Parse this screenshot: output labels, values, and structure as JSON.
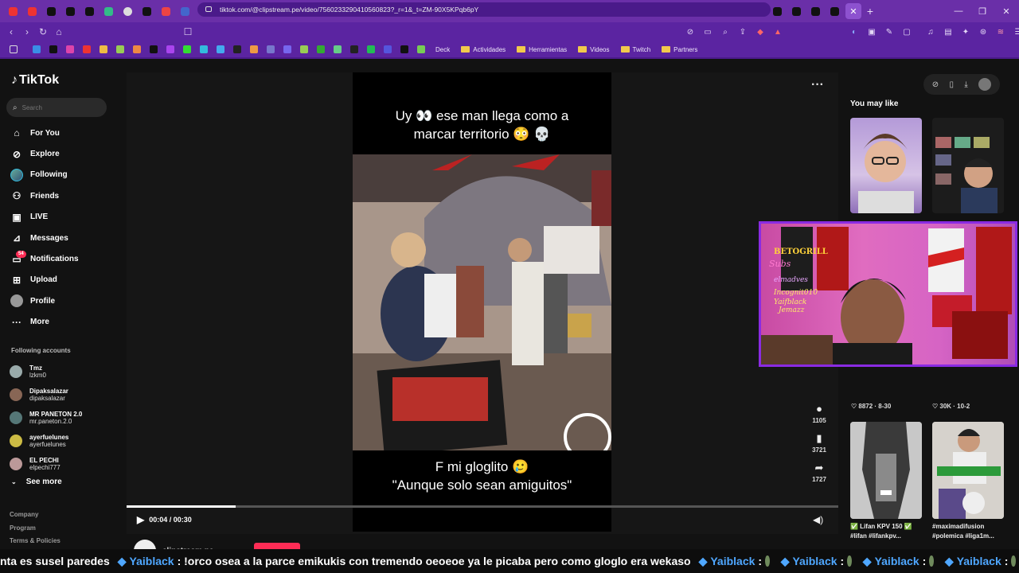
{
  "browser": {
    "url": "tiktok.com/@clipstream.pe/video/7560233290410560823?_r=1&_t=ZM-90X5KPqb6pY",
    "bookmarks": [
      "Deck",
      "Actividades",
      "Herramientas",
      "Videos",
      "Twitch",
      "Partners"
    ]
  },
  "sidebar": {
    "brand": "TikTok",
    "search_placeholder": "Search",
    "menu": [
      {
        "label": "For You",
        "icon": "home-icon"
      },
      {
        "label": "Explore",
        "icon": "compass-icon"
      },
      {
        "label": "Following",
        "icon": "following-avatar"
      },
      {
        "label": "Friends",
        "icon": "friends-icon"
      },
      {
        "label": "LIVE",
        "icon": "live-icon"
      },
      {
        "label": "Messages",
        "icon": "messages-icon"
      },
      {
        "label": "Notifications",
        "icon": "notifications-icon"
      },
      {
        "label": "Upload",
        "icon": "upload-icon"
      },
      {
        "label": "Profile",
        "icon": "profile-avatar"
      },
      {
        "label": "More",
        "icon": "more-icon"
      }
    ],
    "notifications_badge": "54",
    "following_header": "Following accounts",
    "accounts": [
      {
        "name": "Tmz",
        "user": "lzkm0"
      },
      {
        "name": "Dipaksalazar",
        "user": "dipaksalazar"
      },
      {
        "name": "MR PANETON 2.0",
        "user": "mr.paneton.2.0"
      },
      {
        "name": "ayerfuelunes",
        "user": "ayerfuelunes"
      },
      {
        "name": "EL PECHI",
        "user": "elpechi777"
      }
    ],
    "see_more": "See more",
    "footer": [
      "Company",
      "Program",
      "Terms & Policies"
    ]
  },
  "video": {
    "caption_top_1": "Uy 👀 ese man llega como a",
    "caption_top_2": "marcar territorio 😳 💀",
    "caption_bottom_1": "F mi gloglito 🥲",
    "caption_bottom_2": "\"Aunque solo sean amiguitos\"",
    "time": "00:04 / 00:30",
    "progress": 0.153,
    "comments": "1105",
    "saves": "3721",
    "shares": "1727",
    "creator": "clipstream.pe"
  },
  "right": {
    "you_may_like": "You may like",
    "stats_left": "♡ 8872 · 8-30",
    "stats_right": "♡ 30K · 10-2",
    "title_left_1": "✅ Lifan KPV 150 ✅",
    "title_left_2": "#lifan #lifankpv...",
    "title_right_1": "#maximadifusion",
    "title_right_2": "#polemica #liga1m..."
  },
  "cam": {
    "lines": [
      "BETOGRILL",
      "Subs",
      "elmadves",
      "Incognit010",
      "Yaifblack",
      "Jemazz"
    ]
  },
  "ticker": {
    "lead": "nta es susel paredes",
    "user1": "Yaiblack",
    "msg1": ": !orco osea a la parce emikukis con tremendo oeoeoe ya le picaba pero como gloglo era wekaso",
    "user2": "Yaiblack",
    "user3": "Yaiblack",
    "user4": "Yaiblack",
    "user5": "Yaiblack",
    "colon": ":"
  },
  "colors": {
    "accent": "#fe2c55",
    "browser": "#6a2fa8",
    "chat_user": "#4fa7ff"
  }
}
